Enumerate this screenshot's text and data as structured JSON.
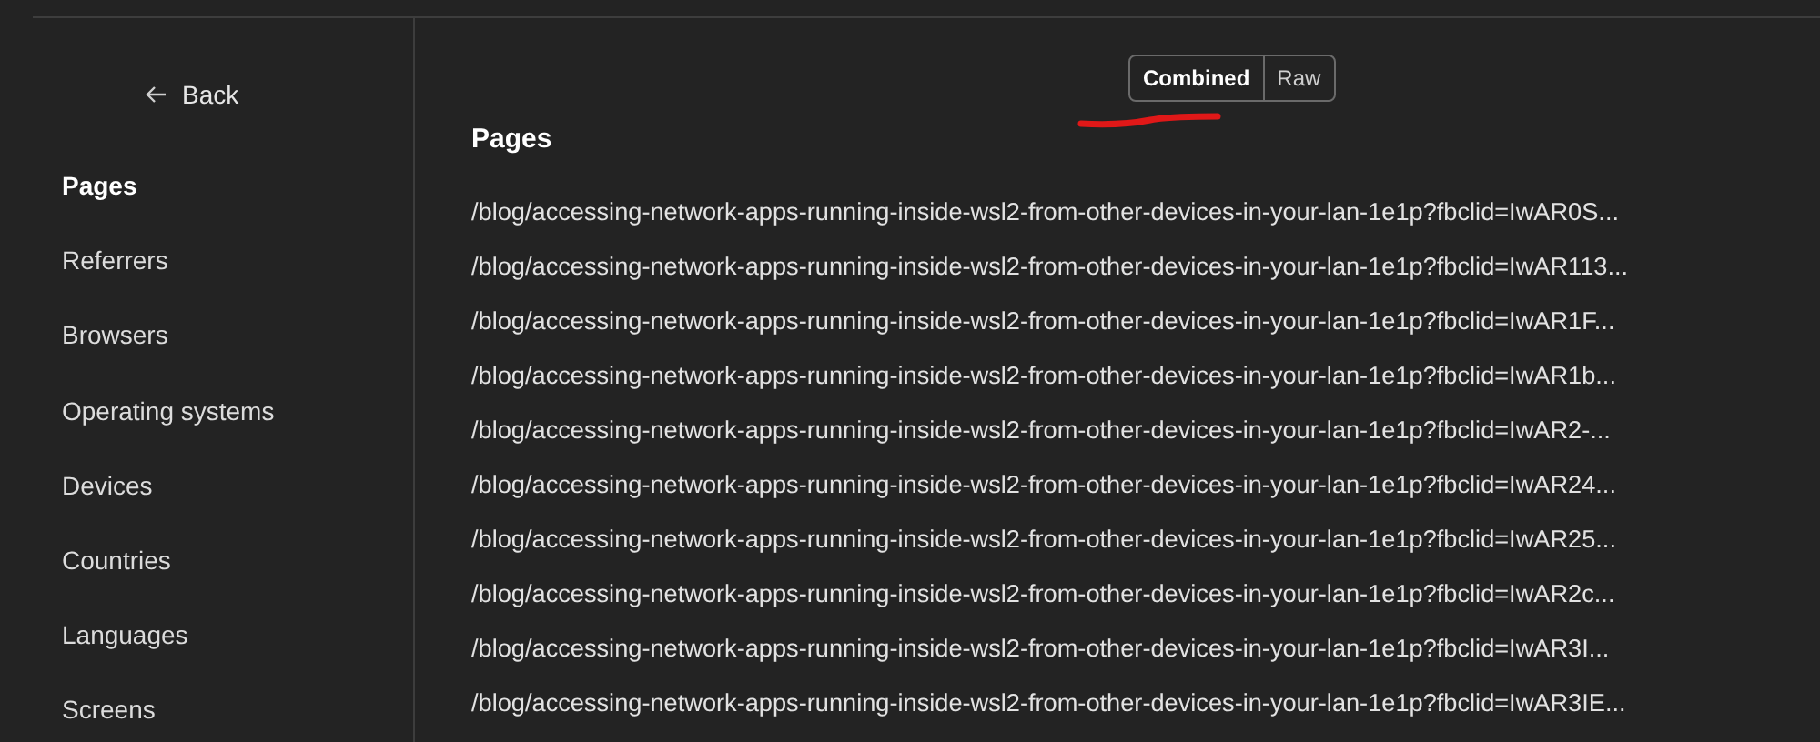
{
  "sidebar": {
    "back": "Back",
    "items": [
      {
        "label": "Pages",
        "selected": true
      },
      {
        "label": "Referrers",
        "selected": false
      },
      {
        "label": "Browsers",
        "selected": false
      },
      {
        "label": "Operating systems",
        "selected": false
      },
      {
        "label": "Devices",
        "selected": false
      },
      {
        "label": "Countries",
        "selected": false
      },
      {
        "label": "Languages",
        "selected": false
      },
      {
        "label": "Screens",
        "selected": false
      }
    ]
  },
  "view_toggle": [
    {
      "label": "Combined",
      "selected": true
    },
    {
      "label": "Raw",
      "selected": false
    }
  ],
  "pages": {
    "title": "Pages",
    "rows": [
      "/blog/accessing-network-apps-running-inside-wsl2-from-other-devices-in-your-lan-1e1p?fbclid=IwAR0S...",
      "/blog/accessing-network-apps-running-inside-wsl2-from-other-devices-in-your-lan-1e1p?fbclid=IwAR113...",
      "/blog/accessing-network-apps-running-inside-wsl2-from-other-devices-in-your-lan-1e1p?fbclid=IwAR1F...",
      "/blog/accessing-network-apps-running-inside-wsl2-from-other-devices-in-your-lan-1e1p?fbclid=IwAR1b...",
      "/blog/accessing-network-apps-running-inside-wsl2-from-other-devices-in-your-lan-1e1p?fbclid=IwAR2-...",
      "/blog/accessing-network-apps-running-inside-wsl2-from-other-devices-in-your-lan-1e1p?fbclid=IwAR24...",
      "/blog/accessing-network-apps-running-inside-wsl2-from-other-devices-in-your-lan-1e1p?fbclid=IwAR25...",
      "/blog/accessing-network-apps-running-inside-wsl2-from-other-devices-in-your-lan-1e1p?fbclid=IwAR2c...",
      "/blog/accessing-network-apps-running-inside-wsl2-from-other-devices-in-your-lan-1e1p?fbclid=IwAR3I...",
      "/blog/accessing-network-apps-running-inside-wsl2-from-other-devices-in-your-lan-1e1p?fbclid=IwAR3IE..."
    ]
  }
}
